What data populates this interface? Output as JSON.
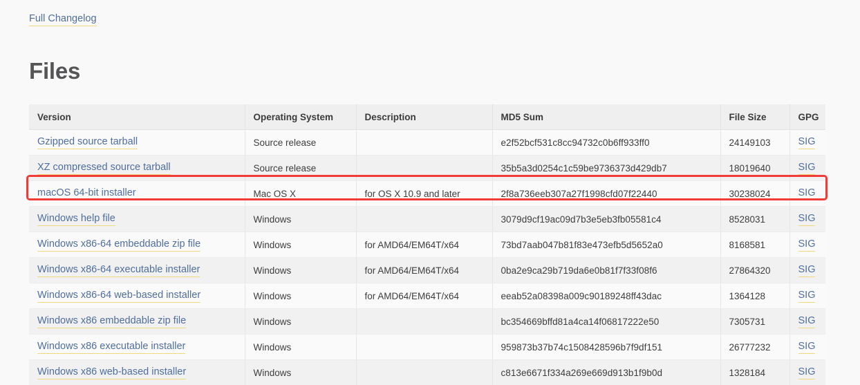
{
  "changelog": {
    "label": "Full Changelog"
  },
  "heading": "Files",
  "table": {
    "columns": [
      "Version",
      "Operating System",
      "Description",
      "MD5 Sum",
      "File Size",
      "GPG"
    ],
    "gpg_label": "SIG",
    "rows": [
      {
        "version": "Gzipped source tarball",
        "os": "Source release",
        "description": "",
        "md5": "e2f52bcf531c8cc94732c0b6ff933ff0",
        "size": "24149103",
        "gpg": "SIG",
        "highlighted": false
      },
      {
        "version": "XZ compressed source tarball",
        "os": "Source release",
        "description": "",
        "md5": "35b5a3d0254c1c59be9736373d429db7",
        "size": "18019640",
        "gpg": "SIG",
        "highlighted": false
      },
      {
        "version": "macOS 64-bit installer",
        "os": "Mac OS X",
        "description": "for OS X 10.9 and later",
        "md5": "2f8a736eeb307a27f1998cfd07f22440",
        "size": "30238024",
        "gpg": "SIG",
        "highlighted": true
      },
      {
        "version": "Windows help file",
        "os": "Windows",
        "description": "",
        "md5": "3079d9cf19ac09d7b3e5eb3fb05581c4",
        "size": "8528031",
        "gpg": "SIG",
        "highlighted": false
      },
      {
        "version": "Windows x86-64 embeddable zip file",
        "os": "Windows",
        "description": "for AMD64/EM64T/x64",
        "md5": "73bd7aab047b81f83e473efb5d5652a0",
        "size": "8168581",
        "gpg": "SIG",
        "highlighted": false
      },
      {
        "version": "Windows x86-64 executable installer",
        "os": "Windows",
        "description": "for AMD64/EM64T/x64",
        "md5": "0ba2e9ca29b719da6e0b81f7f33f08f6",
        "size": "27864320",
        "gpg": "SIG",
        "highlighted": false
      },
      {
        "version": "Windows x86-64 web-based installer",
        "os": "Windows",
        "description": "for AMD64/EM64T/x64",
        "md5": "eeab52a08398a009c90189248ff43dac",
        "size": "1364128",
        "gpg": "SIG",
        "highlighted": false
      },
      {
        "version": "Windows x86 embeddable zip file",
        "os": "Windows",
        "description": "",
        "md5": "bc354669bffd81a4ca14f06817222e50",
        "size": "7305731",
        "gpg": "SIG",
        "highlighted": false
      },
      {
        "version": "Windows x86 executable installer",
        "os": "Windows",
        "description": "",
        "md5": "959873b37b74c1508428596b7f9df151",
        "size": "26777232",
        "gpg": "SIG",
        "highlighted": false
      },
      {
        "version": "Windows x86 web-based installer",
        "os": "Windows",
        "description": "",
        "md5": "c813e6671f334a269e669d913b1f9b0d",
        "size": "1328184",
        "gpg": "SIG",
        "highlighted": false
      }
    ]
  },
  "colors": {
    "page_background": "#f9f9f9",
    "link": "#4f6e9e",
    "link_underline": "#f0d87c",
    "heading": "#555557",
    "header_row": "#efefef",
    "row_odd": "#fafafa",
    "row_even": "#f1f1f1",
    "highlight_border": "#f03b36"
  }
}
